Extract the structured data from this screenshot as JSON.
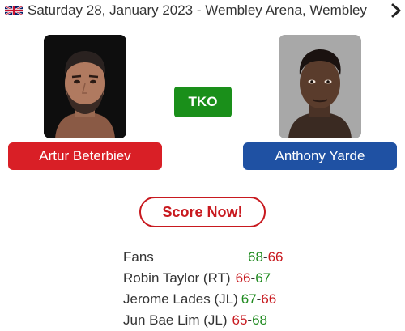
{
  "event": {
    "flag_icon": "uk-flag-icon",
    "text": "Saturday 28, January 2023  -  Wembley Arena, Wembley",
    "chevron_icon": "chevron-right-icon"
  },
  "fight": {
    "result": "TKO",
    "fighter_left": {
      "name": "Artur Beterbiev",
      "color": "#d91f26"
    },
    "fighter_right": {
      "name": "Anthony Yarde",
      "color": "#1f51a3"
    }
  },
  "score_button": {
    "label": "Score Now!"
  },
  "scorecards": [
    {
      "name": "Fans",
      "left": "68",
      "right": "66",
      "left_color": "green",
      "right_color": "red"
    },
    {
      "name": "Robin Taylor (RT)",
      "left": "66",
      "right": "67",
      "left_color": "red",
      "right_color": "green"
    },
    {
      "name": "Jerome Lades (JL)",
      "left": "67",
      "right": "66",
      "left_color": "green",
      "right_color": "red"
    },
    {
      "name": "Jun Bae Lim (JL)",
      "left": "65",
      "right": "68",
      "left_color": "red",
      "right_color": "green"
    }
  ],
  "colors": {
    "green": "#1e8a1e",
    "red": "#c8191f",
    "result_badge": "#1a8f1a"
  }
}
